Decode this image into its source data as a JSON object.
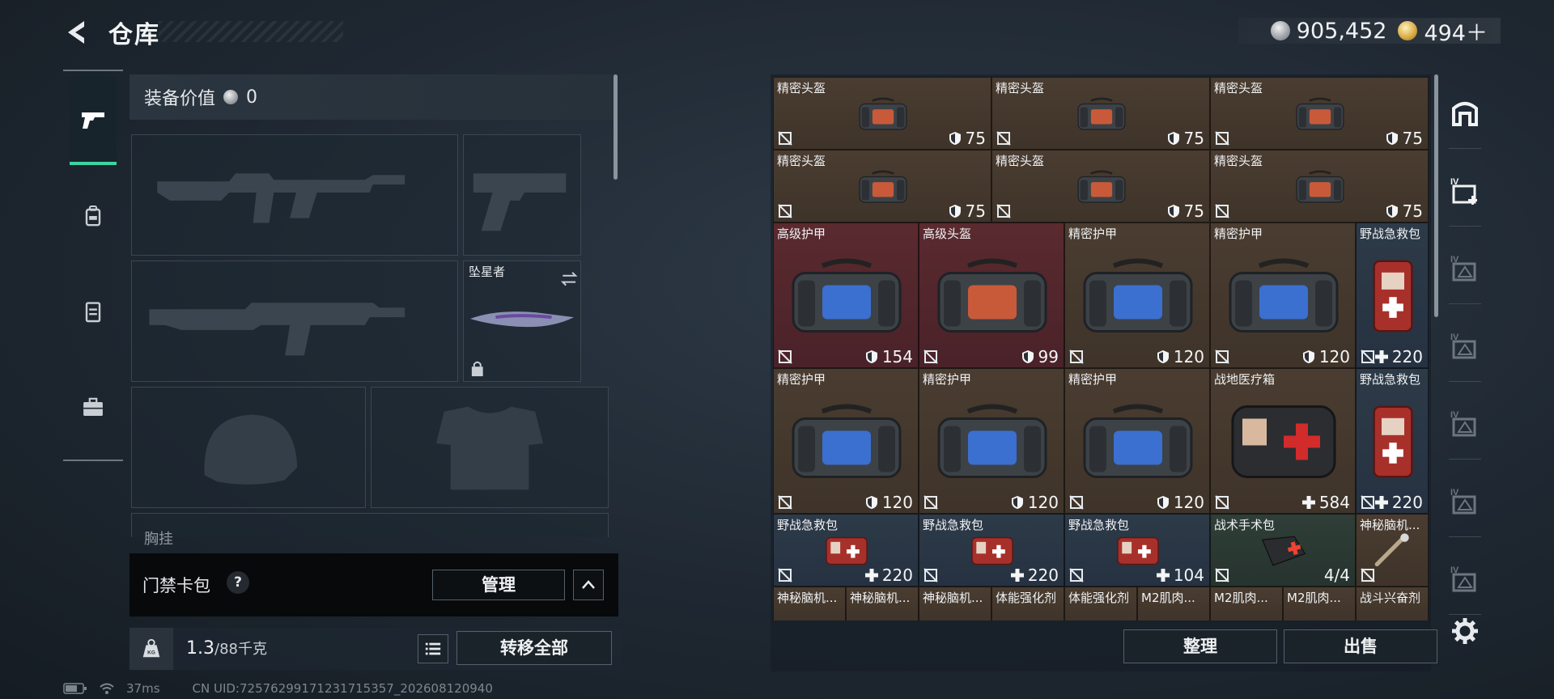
{
  "header": {
    "title": "仓库",
    "currency": [
      {
        "icon": "silver-coin-icon",
        "value": "905,452"
      },
      {
        "icon": "gold-coin-icon",
        "value": "494＋"
      }
    ]
  },
  "loadout": {
    "equip_value_label": "装备价值",
    "equip_value": "0",
    "melee_name": "坠星者",
    "chest_rig_label": "胸挂",
    "keycard_label": "门禁卡包",
    "keycard_help": "?",
    "manage_label": "管理",
    "weight_value": "1.3",
    "weight_max": "/88千克",
    "transfer_all_label": "转移全部"
  },
  "status": {
    "ping": "37ms",
    "uid": "CN UID:72576299171231715357_202608120940"
  },
  "inventory": {
    "rows": [
      [
        {
          "name": "精密头盔",
          "stat": "75",
          "stat_icon": "shield-icon",
          "bg": "brown",
          "item": "helmet-bag"
        },
        {
          "name": "精密头盔",
          "stat": "75",
          "stat_icon": "shield-icon",
          "bg": "brown",
          "item": "helmet-bag"
        },
        {
          "name": "精密头盔",
          "stat": "75",
          "stat_icon": "shield-icon",
          "bg": "brown",
          "item": "helmet-bag"
        }
      ],
      [
        {
          "name": "精密头盔",
          "stat": "75",
          "stat_icon": "shield-icon",
          "bg": "brown",
          "item": "helmet-bag"
        },
        {
          "name": "精密头盔",
          "stat": "75",
          "stat_icon": "shield-icon",
          "bg": "brown",
          "item": "helmet-bag"
        },
        {
          "name": "精密头盔",
          "stat": "75",
          "stat_icon": "shield-icon",
          "bg": "brown",
          "item": "helmet-bag"
        }
      ],
      [
        {
          "name": "高级护甲",
          "stat": "154",
          "stat_icon": "shield-icon",
          "bg": "red",
          "item": "armor-bag"
        },
        {
          "name": "高级头盔",
          "stat": "99",
          "stat_icon": "shield-icon",
          "bg": "red",
          "item": "helmet-bag-large"
        },
        {
          "name": "精密护甲",
          "stat": "120",
          "stat_icon": "shield-icon",
          "bg": "brown",
          "item": "armor-bag"
        },
        {
          "name": "精密护甲",
          "stat": "120",
          "stat_icon": "shield-icon",
          "bg": "brown",
          "item": "armor-bag"
        },
        {
          "name": "野战急救包",
          "stat": "220",
          "stat_icon": "plus-icon",
          "bg": "blue",
          "item": "first-aid-small"
        }
      ],
      [
        {
          "name": "精密护甲",
          "stat": "120",
          "stat_icon": "shield-icon",
          "bg": "brown",
          "item": "armor-bag"
        },
        {
          "name": "精密护甲",
          "stat": "120",
          "stat_icon": "shield-icon",
          "bg": "brown",
          "item": "armor-bag"
        },
        {
          "name": "精密护甲",
          "stat": "120",
          "stat_icon": "shield-icon",
          "bg": "brown",
          "item": "armor-bag"
        },
        {
          "name": "战地医疗箱",
          "stat": "584",
          "stat_icon": "plus-icon",
          "bg": "brown",
          "item": "first-aid-kit"
        },
        {
          "name": "野战急救包",
          "stat": "220",
          "stat_icon": "plus-icon",
          "bg": "blue",
          "item": "first-aid-small"
        }
      ],
      [
        {
          "name": "野战急救包",
          "stat": "220",
          "stat_icon": "plus-icon",
          "bg": "blue",
          "item": "first-aid-pouch"
        },
        {
          "name": "野战急救包",
          "stat": "220",
          "stat_icon": "plus-icon",
          "bg": "blue",
          "item": "first-aid-pouch"
        },
        {
          "name": "野战急救包",
          "stat": "104",
          "stat_icon": "plus-icon",
          "bg": "blue",
          "item": "first-aid-pouch"
        },
        {
          "name": "战术手术包",
          "stat": "4/4",
          "stat_icon": "",
          "bg": "green",
          "item": "surgery-kit"
        },
        {
          "name": "神秘脑机...",
          "stat": "",
          "stat_icon": "",
          "bg": "brown",
          "item": "injector"
        }
      ],
      [
        {
          "name": "神秘脑机...",
          "bg": "brown"
        },
        {
          "name": "神秘脑机...",
          "bg": "brown"
        },
        {
          "name": "神秘脑机...",
          "bg": "brown"
        },
        {
          "name": "体能强化剂",
          "bg": "brown"
        },
        {
          "name": "体能强化剂",
          "bg": "brown"
        },
        {
          "name": "M2肌肉...",
          "bg": "brown"
        },
        {
          "name": "M2肌肉...",
          "bg": "brown"
        },
        {
          "name": "M2肌肉...",
          "bg": "brown"
        },
        {
          "name": "战斗兴奋剂",
          "bg": "brown"
        }
      ]
    ],
    "sort_label": "整理",
    "sell_label": "出售"
  },
  "right_tabs": [
    "storage-home-icon",
    "storage-add-icon",
    "storage-iv-1-icon",
    "storage-iv-2-icon",
    "storage-iv-3-icon",
    "storage-iv-4-icon",
    "storage-iv-5-icon"
  ],
  "colors": {
    "accent": "#3ad6a3",
    "cell_brown": "#4a3c30",
    "cell_red": "#5a2a2f",
    "cell_blue": "#2d3a48",
    "cell_green": "#2f3e38"
  }
}
